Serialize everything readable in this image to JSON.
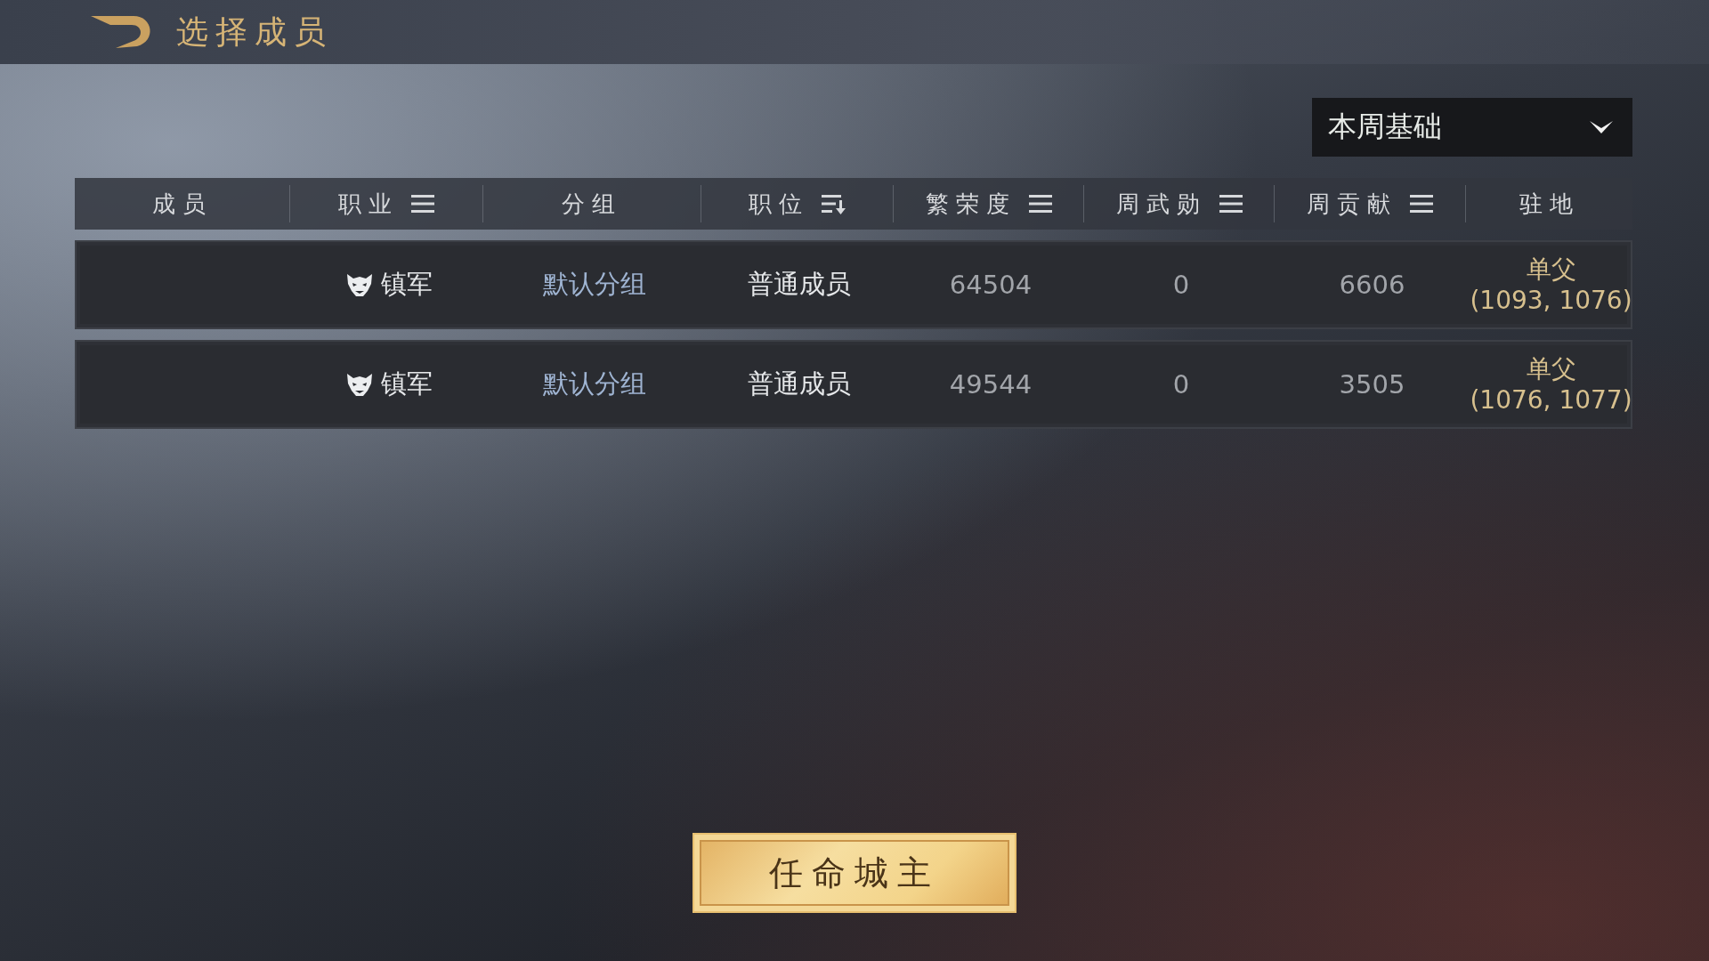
{
  "title": "选择成员",
  "filter_dropdown": {
    "value": "本周基础"
  },
  "table": {
    "columns": [
      {
        "label": "成员",
        "kind": "plain"
      },
      {
        "label": "职业",
        "kind": "filter"
      },
      {
        "label": "分组",
        "kind": "plain"
      },
      {
        "label": "职位",
        "kind": "sort"
      },
      {
        "label": "繁荣度",
        "kind": "filter"
      },
      {
        "label": "周武勋",
        "kind": "filter"
      },
      {
        "label": "周贡献",
        "kind": "filter"
      },
      {
        "label": "驻地",
        "kind": "plain"
      }
    ],
    "rows": [
      {
        "profession": "镇军",
        "group": "默认分组",
        "position": "普通成员",
        "prosperity": "64504",
        "weekly_merit": "0",
        "weekly_contribution": "6606",
        "station_name": "单父",
        "station_coords": "(1093, 1076)"
      },
      {
        "profession": "镇军",
        "group": "默认分组",
        "position": "普通成员",
        "prosperity": "49544",
        "weekly_merit": "0",
        "weekly_contribution": "3505",
        "station_name": "单父",
        "station_coords": "(1076, 1077)"
      }
    ]
  },
  "action_button": {
    "label": "任命城主"
  }
}
